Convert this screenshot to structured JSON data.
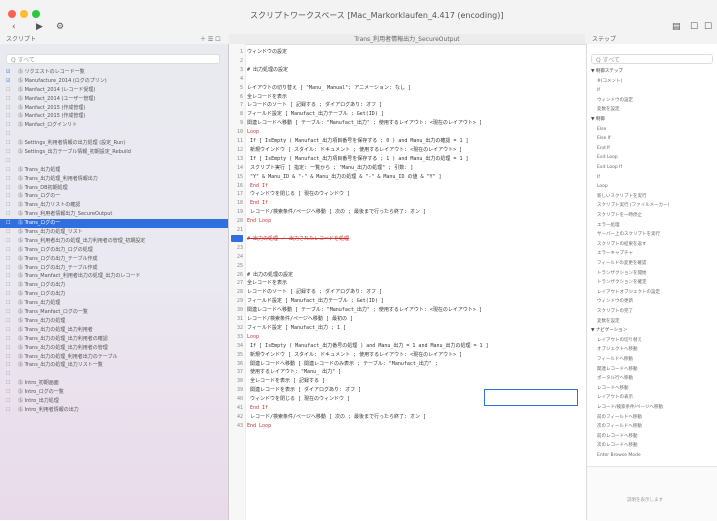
{
  "window": {
    "title": "スクリプトワークスペース [Mac_Markorklaufen_4.417 (encoding)]"
  },
  "left_pane": {
    "header": "スクリプト",
    "search_placeholder": "Q すべて",
    "items": [
      {
        "label": "Ⓢ リクエストのレコード一覧",
        "checked": true
      },
      {
        "label": "Ⓢ Manufacture_2014 (ログのプリン)",
        "checked": true
      },
      {
        "label": "Ⓢ Manfact_2014 (レコード受理)",
        "checked": false
      },
      {
        "label": "Ⓢ Manfact_2014 (ユーザー管理)",
        "checked": false
      },
      {
        "label": "Ⓢ Manfact_2015 (作成管理)",
        "checked": false
      },
      {
        "label": "Ⓢ Manfact_2015 (作成管理)",
        "checked": false
      },
      {
        "label": "Ⓢ Manfact_ログインリト",
        "checked": false
      },
      {
        "label": "",
        "checked": false
      },
      {
        "label": "Ⓢ Settings_利用者情報の出力処理 (設定_Run)",
        "checked": false
      },
      {
        "label": "Ⓢ Settings_出力テーブル情報_初期設定_Rebuild",
        "checked": false
      },
      {
        "label": "",
        "checked": false
      },
      {
        "label": "Ⓢ Trans_出力処理",
        "checked": false
      },
      {
        "label": "Ⓢ Trans_出力処理_利用者情報出力",
        "checked": false
      },
      {
        "label": "Ⓢ Trans_DB初期処理",
        "checked": false
      },
      {
        "label": "Ⓢ Trans_ログの一",
        "checked": false
      },
      {
        "label": "Ⓢ Trans_出力リストの確認",
        "checked": false
      },
      {
        "label": "Ⓢ Trans_利用者情報出力_SecureOutput",
        "checked": false
      },
      {
        "label": "Ⓢ Trans_ログの一",
        "checked": false
      },
      {
        "label": "Ⓢ Trans_出力の処理_リスト",
        "checked": false
      },
      {
        "label": "Ⓢ Trans_利用者出力の処理_出力利用者の管理_初期設定",
        "checked": false
      },
      {
        "label": "Ⓢ Trans_ログの出力_ログの処理",
        "checked": false
      },
      {
        "label": "Ⓢ Trans_ログの出力_テーブル作成",
        "checked": false
      },
      {
        "label": "Ⓢ Trans_ログの出力_テーブル作成",
        "checked": false
      },
      {
        "label": "Ⓢ Trans_Manfact_利用者出力の処理_出力のレコード",
        "checked": false
      },
      {
        "label": "Ⓢ Trans_ログの出力",
        "checked": false
      },
      {
        "label": "Ⓢ Trans_ログの出力",
        "checked": false
      },
      {
        "label": "Ⓢ Trans_出力処理",
        "checked": false
      },
      {
        "label": "Ⓢ Trans_Manfact_ログの一覧",
        "checked": false
      },
      {
        "label": "Ⓢ Trans_出力の処理",
        "checked": false
      },
      {
        "label": "Ⓢ Trans_出力の処理_出力利用者",
        "checked": false
      },
      {
        "label": "Ⓢ Trans_出力の処理_出力利用者の確認",
        "checked": false
      },
      {
        "label": "Ⓢ Trans_出力の処理_出力利用者の管理",
        "checked": false
      },
      {
        "label": "Ⓢ Trans_出力の処理_利用者出力のテーブル",
        "checked": false
      },
      {
        "label": "Ⓢ Trans_出力の処理_出力リスト一覧",
        "checked": false
      },
      {
        "label": "",
        "checked": false
      },
      {
        "label": "Ⓢ Intro_初期画面",
        "checked": false
      },
      {
        "label": "Ⓢ Intro_ログの一覧",
        "checked": false
      },
      {
        "label": "Ⓢ Intro_出力処理",
        "checked": false
      },
      {
        "label": "Ⓢ Intro_利用者情報の出力",
        "checked": false
      }
    ],
    "selected_index": 17
  },
  "editor": {
    "tab_title": "Trans_利用者情報出力_SecureOutput",
    "lines": [
      {
        "n": "1",
        "text": "ウィンドウの設定",
        "kind": "txt"
      },
      {
        "n": "2",
        "text": "",
        "kind": "txt"
      },
      {
        "n": "3",
        "text": "# 出力処理の設定",
        "kind": "txt"
      },
      {
        "n": "4",
        "text": "",
        "kind": "txt"
      },
      {
        "n": "5",
        "text": "レイアウトの切り替え [ \"Manu_ Manual\"; アニメーション: なし ]",
        "kind": "txt"
      },
      {
        "n": "6",
        "text": "全レコードを表示",
        "kind": "txt"
      },
      {
        "n": "7",
        "text": "レコードのソート [ 記録する ; ダイアログあり: オフ ]",
        "kind": "txt"
      },
      {
        "n": "8",
        "text": "フィールド設定 [ Manufact_出力テーブル ; Get(ID) ]",
        "kind": "txt"
      },
      {
        "n": "9",
        "text": "関連レコードへ移動 [ テーブル: \"Manufact_出力\" ; 使用するレイアウト: <現在のレイアウト> ]",
        "kind": "txt"
      },
      {
        "n": "10",
        "text": "Loop",
        "kind": "kw"
      },
      {
        "n": "11",
        "text": "    If [ IsEmpty ( Manufact_出力項目番号を保存する ; 0 ) and Manu_出力の確認 = 1 ]",
        "kind": "txt"
      },
      {
        "n": "12",
        "text": "        新規ウインドウ [ スタイル: ドキュメント ; 使用するレイアウト: <現在のレイアウト> ]",
        "kind": "txt"
      },
      {
        "n": "13",
        "text": "        If [ IsEmpty ( Manufact_出力項目番号を保存する ; 1 ) and Manu_出力の処理 = 1 ]",
        "kind": "txt"
      },
      {
        "n": "14",
        "text": "            スクリプト実行 [ 指定: 一覧から ; \"Manu_出力の処理\" ; 引数: ]",
        "kind": "txt"
      },
      {
        "n": "15",
        "text": "            \"Y\" & Manu_ID & \"-\" & Manu_出力の処理 & \"-\" & Manu_ID の値 & \"Y\" ]",
        "kind": "txt"
      },
      {
        "n": "16",
        "text": "        End If",
        "kind": "kw"
      },
      {
        "n": "17",
        "text": "        ウィンドウを閉じる [ 現在のウィンドウ ]",
        "kind": "txt"
      },
      {
        "n": "18",
        "text": "    End If",
        "kind": "kw"
      },
      {
        "n": "19",
        "text": "    レコード/検索条件/ページへ移動 [ 次の ; 最後まで行ったら終了: オン ]",
        "kind": "txt"
      },
      {
        "n": "20",
        "text": "End Loop",
        "kind": "kw"
      },
      {
        "n": "21",
        "text": "",
        "kind": "txt"
      },
      {
        "n": "22",
        "text": "# 出力の処理 ／ 出力されたレコードを処理",
        "kind": "strike"
      },
      {
        "n": "23",
        "text": "",
        "kind": "txt"
      },
      {
        "n": "24",
        "text": "",
        "kind": "txt"
      },
      {
        "n": "25",
        "text": "",
        "kind": "txt"
      },
      {
        "n": "26",
        "text": "# 出力の処理の設定",
        "kind": "txt"
      },
      {
        "n": "27",
        "text": "全レコードを表示",
        "kind": "txt"
      },
      {
        "n": "28",
        "text": "レコードのソート [ 記録する ; ダイアログあり: オフ ]",
        "kind": "txt"
      },
      {
        "n": "29",
        "text": "フィールド設定 [ Manufact_出力テーブル ; Get(ID) ]",
        "kind": "txt"
      },
      {
        "n": "30",
        "text": "関連レコードへ移動 [ テーブル: \"Manufact_出力\" ; 使用するレイアウト: <現在のレイアウト> ]",
        "kind": "txt"
      },
      {
        "n": "31",
        "text": "レコード/検索条件/ページへ移動 [ 最初の ]",
        "kind": "txt"
      },
      {
        "n": "32",
        "text": "フィールド設定 [ Manufact_出力 ; 1 ]",
        "kind": "txt"
      },
      {
        "n": "33",
        "text": "Loop",
        "kind": "kw"
      },
      {
        "n": "34",
        "text": "    If [ IsEmpty ( Manufact_出力番号の処理 ) and Manu_出力 = 1 and Manu_出力の処理 = 1 ]",
        "kind": "txt"
      },
      {
        "n": "35",
        "text": "        新規ウインドウ [ スタイル: ドキュメント ; 使用するレイアウト: <現在のレイアウト> ]",
        "kind": "txt"
      },
      {
        "n": "36",
        "text": "        関連レコードへ移動 [ 関連レコードのみ表示 ; テーブル: \"Manufact_出力\" ;",
        "kind": "txt"
      },
      {
        "n": "37",
        "text": "        使用するレイアウト: \"Manu_ 出力\" ]",
        "kind": "txt"
      },
      {
        "n": "38",
        "text": "        全レコードを表示 [ 記録する ]",
        "kind": "txt"
      },
      {
        "n": "39",
        "text": "        関連レコードを表示 [ ダイアログあり: オフ ]",
        "kind": "txt"
      },
      {
        "n": "40",
        "text": "        ウィンドウを閉じる [ 現在のウィンドウ ]",
        "kind": "txt"
      },
      {
        "n": "41",
        "text": "    End If",
        "kind": "kw"
      },
      {
        "n": "42",
        "text": "    レコード/検索条件/ページへ移動 [ 次の ; 最後まで行ったら終了: オン ]",
        "kind": "txt"
      },
      {
        "n": "43",
        "text": "End Loop",
        "kind": "kw"
      }
    ],
    "highlight_text": "and Manu_出力 = 1 and"
  },
  "right_pane": {
    "header": "ステップ",
    "search_placeholder": "Q すべて",
    "items": [
      {
        "label": "▼ 制御ステップ",
        "group": true
      },
      {
        "label": "#(コメント)",
        "group": false
      },
      {
        "label": "If",
        "group": false
      },
      {
        "label": "ウィンドウの設定",
        "group": false
      },
      {
        "label": "変数を設定",
        "group": false
      },
      {
        "label": "▼ 制御",
        "group": true
      },
      {
        "label": "Else",
        "group": false
      },
      {
        "label": "Else If",
        "group": false
      },
      {
        "label": "End If",
        "group": false
      },
      {
        "label": "Exit Loop",
        "group": false
      },
      {
        "label": "Exit Loop If",
        "group": false
      },
      {
        "label": "If",
        "group": false
      },
      {
        "label": "Loop",
        "group": false
      },
      {
        "label": "新しいスクリプトを実行",
        "group": false
      },
      {
        "label": "スクリプト実行 (ファイルメーカー)",
        "group": false
      },
      {
        "label": "スクリプトを一時停止",
        "group": false
      },
      {
        "label": "エラー処理",
        "group": false
      },
      {
        "label": "サーバー上のスクリプトを実行",
        "group": false
      },
      {
        "label": "スクリプトの結果を返す",
        "group": false
      },
      {
        "label": "エラーキャプチャ",
        "group": false
      },
      {
        "label": "フィールドの変更を確認",
        "group": false
      },
      {
        "label": "トランザクションを開始",
        "group": false
      },
      {
        "label": "トランザクションを確定",
        "group": false
      },
      {
        "label": "レイアウトオブジェクトの設定",
        "group": false
      },
      {
        "label": "ウィンドウの更新",
        "group": false
      },
      {
        "label": "スクリプトの完了",
        "group": false
      },
      {
        "label": "変数を設定",
        "group": false
      },
      {
        "label": "▼ ナビゲーション",
        "group": true
      },
      {
        "label": "レイアウトの切り替え",
        "group": false
      },
      {
        "label": "オブジェクトへ移動",
        "group": false
      },
      {
        "label": "フィールドへ移動",
        "group": false
      },
      {
        "label": "関連レコードへ移動",
        "group": false
      },
      {
        "label": "ポータル行へ移動",
        "group": false
      },
      {
        "label": "レコードへ移動",
        "group": false
      },
      {
        "label": "レイアウトの表示",
        "group": false
      },
      {
        "label": "レコード/検索条件/ページへ移動",
        "group": false
      },
      {
        "label": "前のフィールドへ移動",
        "group": false
      },
      {
        "label": "次のフィールドへ移動",
        "group": false
      },
      {
        "label": "前のレコードへ移動",
        "group": false
      },
      {
        "label": "次のレコードへ移動",
        "group": false
      },
      {
        "label": "Enter Browse Mode",
        "group": false
      }
    ],
    "bottom_label": "説明を表示します"
  },
  "colors": {
    "accent": "#2f6fe0",
    "keyword": "#cc3333"
  }
}
